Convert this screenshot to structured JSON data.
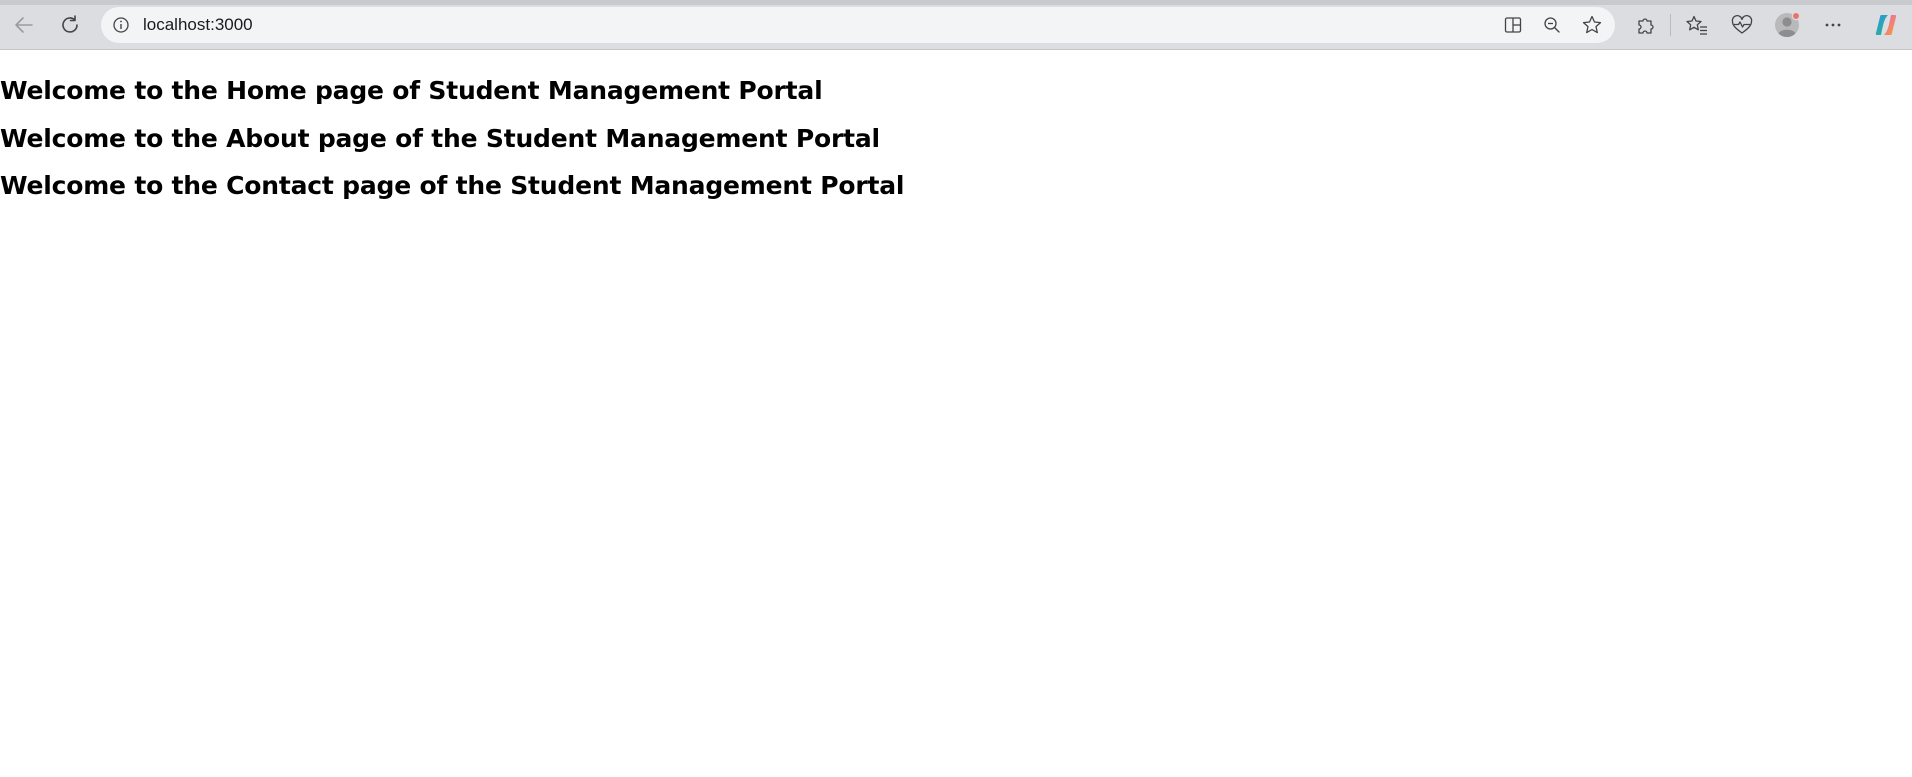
{
  "browser": {
    "url": "localhost:3000",
    "icons": {
      "back": "back-arrow-icon",
      "refresh": "refresh-icon",
      "site_info": "info-icon",
      "split_screen": "split-screen-icon",
      "zoom_out": "zoom-out-icon",
      "favorite": "star-icon",
      "extensions": "puzzle-icon",
      "favorites": "favorites-list-icon",
      "health": "heart-pulse-icon",
      "profile": "avatar-icon",
      "more": "more-dots-icon",
      "copilot": "copilot-icon"
    },
    "colors": {
      "toolbar": "#dcdde0",
      "address_bar": "#f3f4f5",
      "notification_dot": "#e8756b"
    }
  },
  "page": {
    "headings": [
      "Welcome to the Home page of Student Management Portal",
      "Welcome to the About page of the Student Management Portal",
      "Welcome to the Contact page of the Student Management Portal"
    ]
  }
}
